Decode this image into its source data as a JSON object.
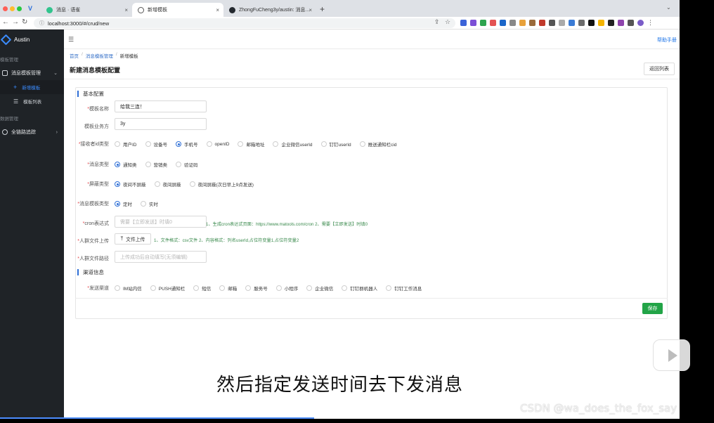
{
  "browser": {
    "tabs": [
      {
        "label": "消息 · 语雀",
        "active": false
      },
      {
        "label": "新增模板",
        "active": true
      },
      {
        "label": "ZhongFuCheng3y/austin: 消息...",
        "active": false
      }
    ],
    "url": "localhost:3000/#/crud/new"
  },
  "sidebar": {
    "app_name": "Austin",
    "sections": [
      {
        "title": "模板管理",
        "items": [
          {
            "label": "消息模板管理",
            "children": [
              {
                "label": "新增模板",
                "active": true
              },
              {
                "label": "模板列表",
                "active": false
              }
            ]
          }
        ]
      },
      {
        "title": "数据管理",
        "items": [
          {
            "label": "全链路追踪"
          }
        ]
      }
    ]
  },
  "header": {
    "help": "帮助手册"
  },
  "breadcrumb": [
    "首页",
    "消息模板管理",
    "新增模板"
  ],
  "page": {
    "title": "新建消息模板配置",
    "back": "返回列表"
  },
  "form": {
    "basic_section": "基本配置",
    "name_label": "模板名称",
    "name_value": "给我三连！",
    "biz_label": "模板业务方",
    "biz_value": "3y",
    "receiver_label": "接收者id类型",
    "receiver_options": [
      "用户ID",
      "设备号",
      "手机号",
      "openID",
      "邮箱地址",
      "企业微信userId",
      "钉钉userId",
      "推送通知栏cid"
    ],
    "receiver_selected": 2,
    "msg_type_label": "消息类型",
    "msg_type_options": [
      "通知类",
      "营销类",
      "验证码"
    ],
    "msg_type_selected": 0,
    "shield_label": "屏蔽类型",
    "shield_options": [
      "夜间不屏蔽",
      "夜间屏蔽",
      "夜间屏蔽(次日早上9点发送)"
    ],
    "shield_selected": 0,
    "tpl_type_label": "消息模板类型",
    "tpl_type_options": [
      "定时",
      "实时"
    ],
    "tpl_type_selected": 0,
    "cron_label": "cron表达式",
    "cron_placeholder": "需要【立即发送】时填0",
    "cron_hint": "1、生成cron表达式页面：https://www.matools.com/cron 2、需要【立即发送】时填0",
    "upload_label": "人群文件上传",
    "upload_button": "文件上传",
    "upload_hint": "1、文件格式：csv文件 2、内容格式：列名userId,占位符变量1,占位符变量2",
    "path_label": "人群文件路径",
    "path_placeholder": "上传成功后自动填写(无须编辑)",
    "channel_section": "渠道信息",
    "channel_label": "发送渠道",
    "channel_options": [
      "IM站内信",
      "PUSH通知栏",
      "短信",
      "邮箱",
      "服务号",
      "小程序",
      "企业微信",
      "钉钉群机器人",
      "钉钉工作消息"
    ],
    "save": "保存"
  },
  "caption": "然后指定发送时间去下发消息",
  "watermark": "CSDN @wa_does_the_fox_say",
  "colors": {
    "primary": "#2f6fd6",
    "save": "#22a447",
    "sidebar": "#1f2327",
    "hint": "#3a8a4d"
  }
}
